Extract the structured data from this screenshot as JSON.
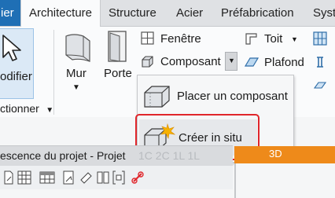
{
  "tabs": {
    "t0": "ier",
    "t1": "Architecture",
    "t2": "Structure",
    "t3": "Acier",
    "t4": "Préfabrication",
    "t5": "Syst"
  },
  "ribbon": {
    "modifier": "odifier",
    "selectionner": "ctionner",
    "mur": "Mur",
    "porte": "Porte",
    "fenetre": "Fenêtre",
    "composant": "Composant",
    "toit": "Toit",
    "plafond": "Plafond"
  },
  "menu": {
    "placer": "Placer un composant",
    "creer": "Créer in situ"
  },
  "panel": {
    "title": "escence du projet - Projet"
  },
  "colors": {
    "accent": "#1f6fb5",
    "highlight": "#e0262b",
    "orange": "#ee8a1a"
  }
}
